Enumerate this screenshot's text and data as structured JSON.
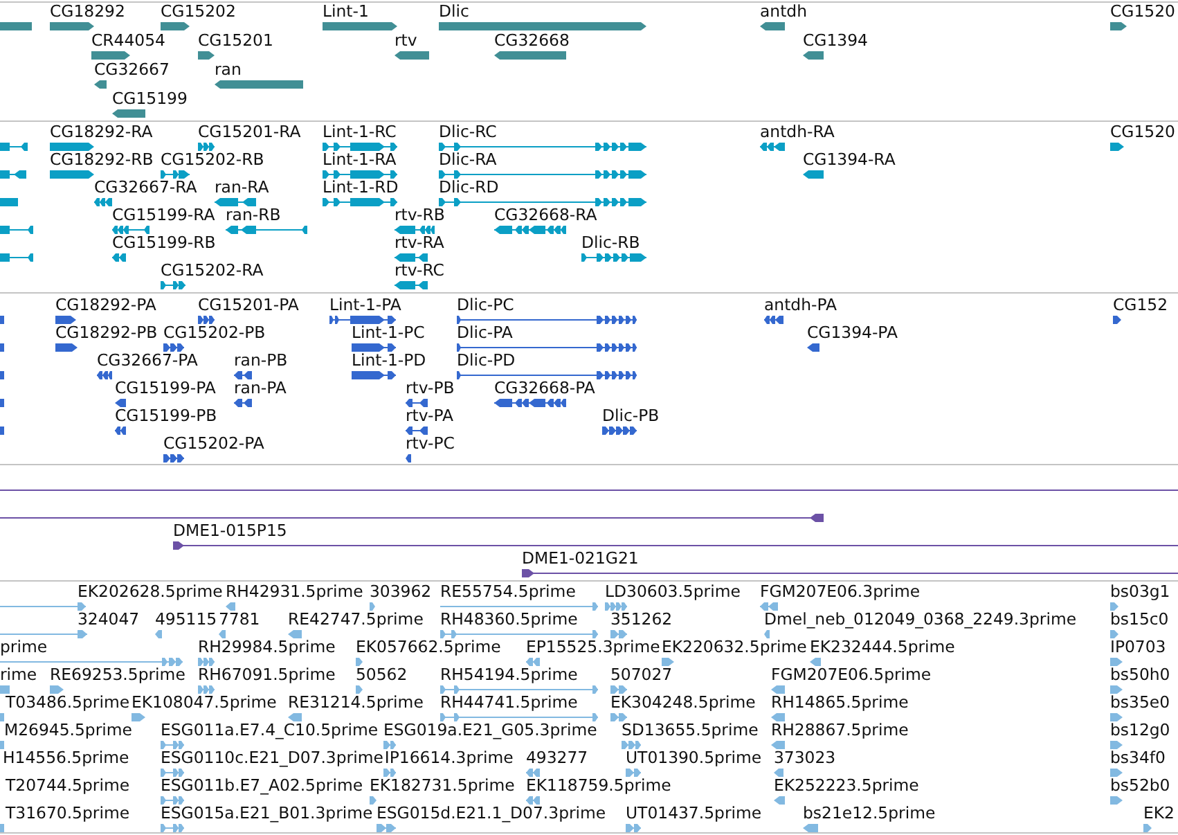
{
  "tracks": [
    {
      "kind": "gene",
      "features": [
        {
          "reverse": true
        },
        {
          "label": "CG18292",
          "reverse": false
        },
        {
          "label": "CG15202",
          "reverse": false
        },
        {
          "label": "Lint-1",
          "reverse": false
        },
        {
          "label": "Dlic",
          "reverse": false
        },
        {
          "label": "antdh",
          "reverse": true
        },
        {
          "label": "CG1520",
          "reverse": false
        },
        {
          "label": "CR44054",
          "reverse": false
        },
        {
          "label": "CG15201",
          "reverse": false
        },
        {
          "label": "rtv",
          "reverse": true
        },
        {
          "label": "CG32668",
          "reverse": true
        },
        {
          "label": "CG1394",
          "reverse": true
        },
        {
          "label": "CG32667",
          "reverse": true
        },
        {
          "label": "ran",
          "reverse": true
        },
        {
          "label": "CG15199",
          "reverse": true
        }
      ]
    },
    {
      "kind": "transcript",
      "features": [
        {
          "reverse": true
        },
        {
          "label": "CG18292-RA",
          "reverse": false
        },
        {
          "label": "CG15201-RA",
          "reverse": false
        },
        {
          "label": "Lint-1-RC",
          "reverse": false
        },
        {
          "label": "Dlic-RC",
          "reverse": false
        },
        {
          "label": "antdh-RA",
          "reverse": true
        },
        {
          "label": "CG1520",
          "reverse": false
        },
        {
          "reverse": true
        },
        {
          "label": "CG18292-RB",
          "reverse": false
        },
        {
          "label": "CG15202-RB",
          "reverse": false
        },
        {
          "label": "Lint-1-RA",
          "reverse": false
        },
        {
          "label": "Dlic-RA",
          "reverse": false
        },
        {
          "label": "CG1394-RA",
          "reverse": true
        },
        {
          "reverse": true
        },
        {
          "label": "CG32667-RA",
          "reverse": true
        },
        {
          "label": "ran-RA",
          "reverse": true
        },
        {
          "label": "Lint-1-RD",
          "reverse": false
        },
        {
          "label": "Dlic-RD",
          "reverse": false
        },
        {
          "reverse": true
        },
        {
          "label": "CG15199-RA",
          "reverse": true
        },
        {
          "label": "ran-RB",
          "reverse": true
        },
        {
          "label": "rtv-RB",
          "reverse": true
        },
        {
          "label": "CG32668-RA",
          "reverse": true
        },
        {
          "reverse": true
        },
        {
          "label": "CG15199-RB",
          "reverse": true
        },
        {
          "label": "rtv-RA",
          "reverse": true
        },
        {
          "label": "Dlic-RB",
          "reverse": false
        },
        {
          "label": "CG15202-RA",
          "reverse": false
        },
        {
          "label": "rtv-RC",
          "reverse": true
        }
      ]
    },
    {
      "kind": "protein",
      "features": [
        {
          "reverse": true
        },
        {
          "label": "CG18292-PA",
          "reverse": false
        },
        {
          "label": "CG15201-PA",
          "reverse": false
        },
        {
          "label": "Lint-1-PA",
          "reverse": false
        },
        {
          "label": "Dlic-PC",
          "reverse": false
        },
        {
          "label": "antdh-PA",
          "reverse": true
        },
        {
          "label": "CG152",
          "reverse": false
        },
        {
          "reverse": true
        },
        {
          "label": "CG18292-PB",
          "reverse": false
        },
        {
          "label": "CG15202-PB",
          "reverse": false
        },
        {
          "label": "Lint-1-PC",
          "reverse": false
        },
        {
          "label": "Dlic-PA",
          "reverse": false
        },
        {
          "label": "CG1394-PA",
          "reverse": true
        },
        {
          "reverse": true
        },
        {
          "label": "CG32667-PA",
          "reverse": true
        },
        {
          "label": "ran-PB",
          "reverse": true
        },
        {
          "label": "Lint-1-PD",
          "reverse": false
        },
        {
          "label": "Dlic-PD",
          "reverse": false
        },
        {
          "reverse": true
        },
        {
          "label": "CG15199-PA",
          "reverse": true
        },
        {
          "label": "ran-PA",
          "reverse": true
        },
        {
          "label": "rtv-PB",
          "reverse": true
        },
        {
          "label": "CG32668-PA",
          "reverse": true
        },
        {
          "reverse": true
        },
        {
          "label": "CG15199-PB",
          "reverse": true
        },
        {
          "label": "rtv-PA",
          "reverse": true
        },
        {
          "label": "Dlic-PB",
          "reverse": false
        },
        {
          "label": "CG15202-PA",
          "reverse": false
        },
        {
          "label": "rtv-PC",
          "reverse": true
        }
      ]
    },
    {
      "kind": "clone",
      "features": [
        {
          "reverse": true
        },
        {
          "label": "DME1-015P15",
          "reverse": false
        },
        {
          "label": "DME1-021G21",
          "reverse": false
        }
      ]
    },
    {
      "kind": "est",
      "features": [
        {
          "label": "EK202628.5prime",
          "reverse": false
        },
        {
          "label": "RH42931.5prime",
          "reverse": true
        },
        {
          "label": "303962",
          "reverse": false
        },
        {
          "label": "RE55754.5prime",
          "reverse": false
        },
        {
          "label": "LD30603.5prime",
          "reverse": false
        },
        {
          "label": "FGM207E06.3prime",
          "reverse": true
        },
        {
          "label": "bs03g1",
          "reverse": false
        },
        {
          "label": "324047",
          "reverse": false
        },
        {
          "label": "495115",
          "reverse": true
        },
        {
          "label": "7781",
          "reverse": true
        },
        {
          "label": "RE42747.5prime",
          "reverse": true
        },
        {
          "label": "RH48360.5prime",
          "reverse": false
        },
        {
          "label": "351262",
          "reverse": false
        },
        {
          "label": "Dmel_neb_012049_0368_2249.3prime",
          "reverse": true
        },
        {
          "label": "bs15c0",
          "reverse": false
        },
        {
          "label": "prime",
          "reverse": false
        },
        {
          "label": "RH29984.5prime",
          "reverse": false
        },
        {
          "label": "EK057662.5prime",
          "reverse": false
        },
        {
          "label": "EP15525.3prime",
          "reverse": true
        },
        {
          "label": "EK220632.5prime",
          "reverse": false
        },
        {
          "label": "EK232444.5prime",
          "reverse": true
        },
        {
          "label": "IP0703",
          "reverse": false
        },
        {
          "label": "rime",
          "reverse": true
        },
        {
          "label": "RE69253.5prime",
          "reverse": false
        },
        {
          "label": "RH67091.5prime",
          "reverse": false
        },
        {
          "label": "50562",
          "reverse": false
        },
        {
          "label": "RH54194.5prime",
          "reverse": false
        },
        {
          "label": "507027",
          "reverse": false
        },
        {
          "label": "FGM207E06.5prime",
          "reverse": true
        },
        {
          "label": "bs50h0",
          "reverse": false
        },
        {
          "label": "T03486.5prime",
          "reverse": true
        },
        {
          "label": "EK108047.5prime",
          "reverse": false
        },
        {
          "label": "RE31214.5prime",
          "reverse": true
        },
        {
          "label": "RH44741.5prime",
          "reverse": false
        },
        {
          "label": "EK304248.5prime",
          "reverse": false
        },
        {
          "label": "RH14865.5prime",
          "reverse": true
        },
        {
          "label": "bs35e0",
          "reverse": false
        },
        {
          "label": "M26945.5prime",
          "reverse": true
        },
        {
          "label": "ESG011a.E7.4_C10.5prime",
          "reverse": false
        },
        {
          "label": "ESG019a.E21_G05.3prime",
          "reverse": false
        },
        {
          "label": "SD13655.5prime",
          "reverse": false
        },
        {
          "label": "RH28867.5prime",
          "reverse": true
        },
        {
          "label": "bs12g0",
          "reverse": false
        },
        {
          "label": "H14556.5prime"
        },
        {
          "label": "ESG0110c.E21_D07.3prime",
          "reverse": false
        },
        {
          "label": "IP16614.3prime",
          "reverse": false
        },
        {
          "label": "493277",
          "reverse": true
        },
        {
          "label": "UT01390.5prime",
          "reverse": false
        },
        {
          "label": "373023",
          "reverse": true
        },
        {
          "label": "bs34f0",
          "reverse": false
        },
        {
          "label": "T20744.5prime"
        },
        {
          "label": "ESG011b.E7_A02.5prime",
          "reverse": false
        },
        {
          "label": "EK182731.5prime",
          "reverse": false
        },
        {
          "label": "EK118759.5prime",
          "reverse": true
        },
        {
          "label": "EK252223.5prime",
          "reverse": true
        },
        {
          "label": "bs52b0",
          "reverse": false
        },
        {
          "label": "T31670.5prime",
          "reverse": true
        },
        {
          "label": "ESG015a.E21_B01.3prime",
          "reverse": false
        },
        {
          "label": "ESG015d.E21.1_D07.3prime",
          "reverse": false
        },
        {
          "label": "UT01437.5prime",
          "reverse": false
        },
        {
          "label": "bs21e12.5prime",
          "reverse": true
        },
        {
          "label": "EK2",
          "reverse": false
        }
      ]
    }
  ]
}
